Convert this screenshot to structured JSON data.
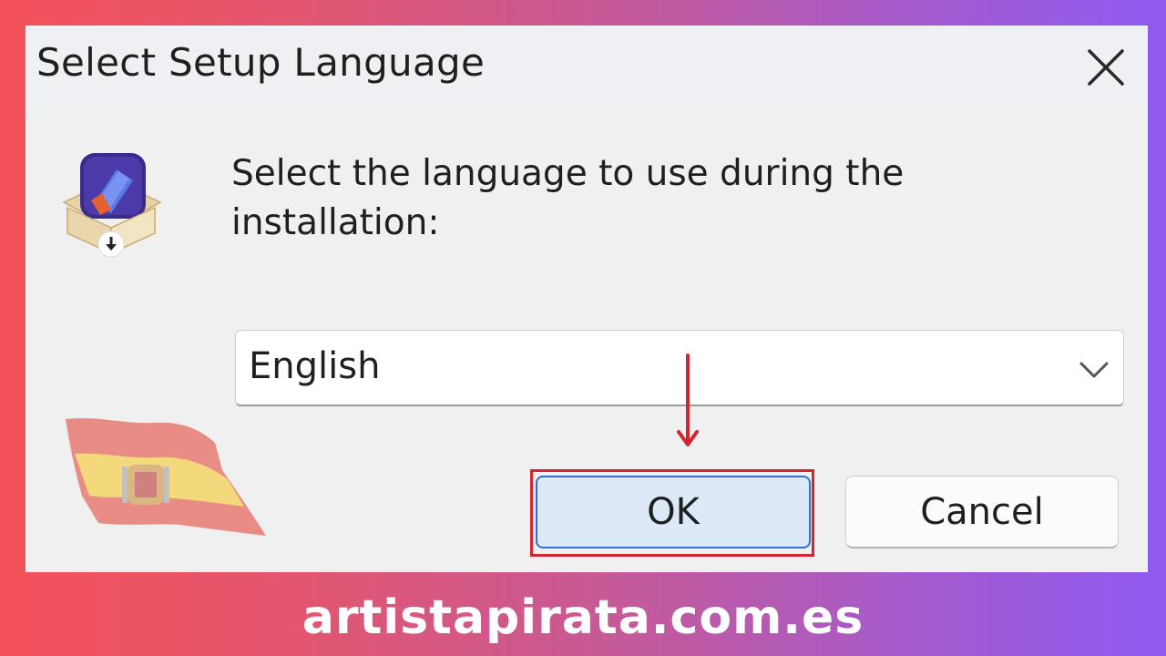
{
  "window": {
    "title": "Select Setup Language",
    "close_icon": "close-icon"
  },
  "dialog": {
    "app_icon": "installer-box-icon",
    "prompt": "Select the language to use during the installation:",
    "language_select": {
      "selected": "English",
      "chevron_icon": "chevron-down-icon"
    },
    "buttons": {
      "ok_label": "OK",
      "cancel_label": "Cancel"
    }
  },
  "overlay": {
    "flag_icon": "spain-flag",
    "arrow_icon": "red-arrow-down-icon",
    "highlight_color": "#d42430"
  },
  "footer": {
    "watermark": "artistapirata.com.es"
  },
  "colors": {
    "ok_button_bg": "#dde9f7",
    "ok_button_border": "#2f6fd6",
    "dialog_bg": "#f0f0f0",
    "gradient_start": "#f4525a",
    "gradient_end": "#8f5af0"
  }
}
